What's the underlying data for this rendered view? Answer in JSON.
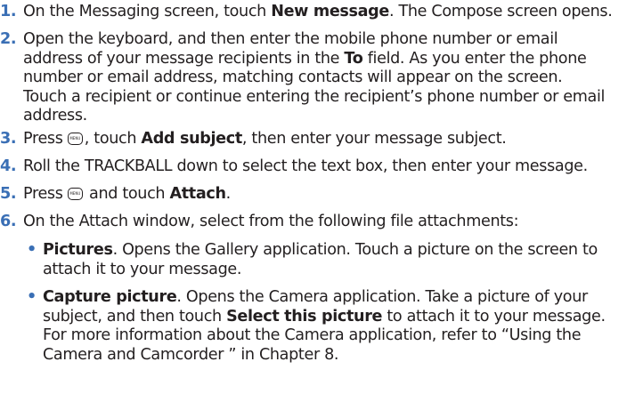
{
  "steps": [
    {
      "num": "1.",
      "parts": [
        {
          "t": "On the Messaging screen, touch "
        },
        {
          "t": "New message",
          "b": true
        },
        {
          "t": ". The Compose screen opens."
        }
      ]
    },
    {
      "num": "2.",
      "lines": [
        "Open the keyboard, and then enter the mobile phone number or email",
        "number or email address, matching contacts will appear on the screen.",
        "Touch a recipient or continue entering the recipient’s phone number or email",
        "address."
      ],
      "line2_parts": [
        {
          "t": "address of your message recipients in the "
        },
        {
          "t": "To",
          "b": true
        },
        {
          "t": " field. As you enter the phone"
        }
      ]
    },
    {
      "num": "3.",
      "press": "Press ",
      "menu_key": "MENU",
      "after_key": ", touch ",
      "bold": "Add subject",
      "rest": ", then enter your message subject."
    },
    {
      "num": "4.",
      "text": "Roll the TRACKBALL down to select the text box, then enter your message."
    },
    {
      "num": "5.",
      "press": "Press ",
      "menu_key": "MENU",
      "after_key": " and touch ",
      "bold": "Attach",
      "rest": "."
    },
    {
      "num": "6.",
      "text": "On the Attach window, select from the following file attachments:"
    }
  ],
  "bullets": [
    {
      "bullet": "•",
      "title": "Pictures",
      "line1_rest": ". Opens the Gallery application. Touch a picture on the screen to",
      "line2": "attach it to your message."
    },
    {
      "bullet": "•",
      "title": "Capture picture",
      "line1_rest": ". Opens the Camera application. Take a picture of your",
      "line2_pre": "subject, and then touch ",
      "line2_bold": "Select this picture",
      "line2_post": " to attach it to your message.",
      "line3": "For more information about the Camera application, refer to “Using the",
      "line4": "Camera and Camcorder ” in Chapter 8."
    }
  ]
}
